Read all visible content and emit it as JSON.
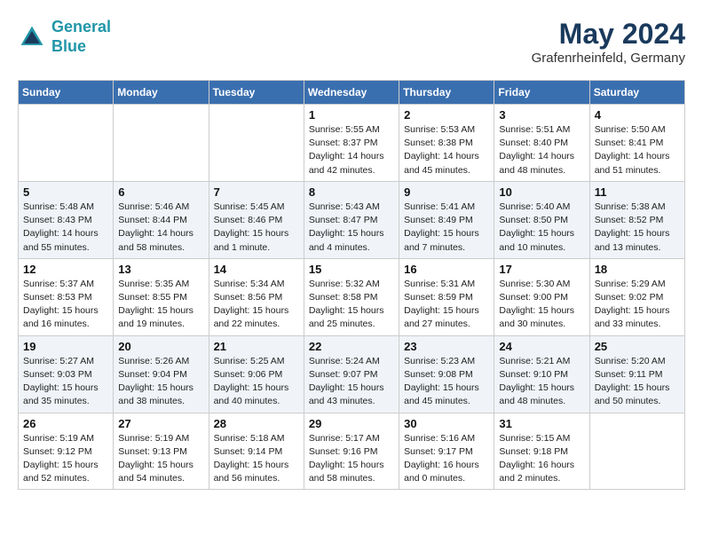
{
  "header": {
    "logo": {
      "line1": "General",
      "line2": "Blue"
    },
    "title": "May 2024",
    "location": "Grafenrheinfeld, Germany"
  },
  "weekdays": [
    "Sunday",
    "Monday",
    "Tuesday",
    "Wednesday",
    "Thursday",
    "Friday",
    "Saturday"
  ],
  "weeks": [
    [
      {
        "day": "",
        "info": ""
      },
      {
        "day": "",
        "info": ""
      },
      {
        "day": "",
        "info": ""
      },
      {
        "day": "1",
        "info": "Sunrise: 5:55 AM\nSunset: 8:37 PM\nDaylight: 14 hours\nand 42 minutes."
      },
      {
        "day": "2",
        "info": "Sunrise: 5:53 AM\nSunset: 8:38 PM\nDaylight: 14 hours\nand 45 minutes."
      },
      {
        "day": "3",
        "info": "Sunrise: 5:51 AM\nSunset: 8:40 PM\nDaylight: 14 hours\nand 48 minutes."
      },
      {
        "day": "4",
        "info": "Sunrise: 5:50 AM\nSunset: 8:41 PM\nDaylight: 14 hours\nand 51 minutes."
      }
    ],
    [
      {
        "day": "5",
        "info": "Sunrise: 5:48 AM\nSunset: 8:43 PM\nDaylight: 14 hours\nand 55 minutes."
      },
      {
        "day": "6",
        "info": "Sunrise: 5:46 AM\nSunset: 8:44 PM\nDaylight: 14 hours\nand 58 minutes."
      },
      {
        "day": "7",
        "info": "Sunrise: 5:45 AM\nSunset: 8:46 PM\nDaylight: 15 hours\nand 1 minute."
      },
      {
        "day": "8",
        "info": "Sunrise: 5:43 AM\nSunset: 8:47 PM\nDaylight: 15 hours\nand 4 minutes."
      },
      {
        "day": "9",
        "info": "Sunrise: 5:41 AM\nSunset: 8:49 PM\nDaylight: 15 hours\nand 7 minutes."
      },
      {
        "day": "10",
        "info": "Sunrise: 5:40 AM\nSunset: 8:50 PM\nDaylight: 15 hours\nand 10 minutes."
      },
      {
        "day": "11",
        "info": "Sunrise: 5:38 AM\nSunset: 8:52 PM\nDaylight: 15 hours\nand 13 minutes."
      }
    ],
    [
      {
        "day": "12",
        "info": "Sunrise: 5:37 AM\nSunset: 8:53 PM\nDaylight: 15 hours\nand 16 minutes."
      },
      {
        "day": "13",
        "info": "Sunrise: 5:35 AM\nSunset: 8:55 PM\nDaylight: 15 hours\nand 19 minutes."
      },
      {
        "day": "14",
        "info": "Sunrise: 5:34 AM\nSunset: 8:56 PM\nDaylight: 15 hours\nand 22 minutes."
      },
      {
        "day": "15",
        "info": "Sunrise: 5:32 AM\nSunset: 8:58 PM\nDaylight: 15 hours\nand 25 minutes."
      },
      {
        "day": "16",
        "info": "Sunrise: 5:31 AM\nSunset: 8:59 PM\nDaylight: 15 hours\nand 27 minutes."
      },
      {
        "day": "17",
        "info": "Sunrise: 5:30 AM\nSunset: 9:00 PM\nDaylight: 15 hours\nand 30 minutes."
      },
      {
        "day": "18",
        "info": "Sunrise: 5:29 AM\nSunset: 9:02 PM\nDaylight: 15 hours\nand 33 minutes."
      }
    ],
    [
      {
        "day": "19",
        "info": "Sunrise: 5:27 AM\nSunset: 9:03 PM\nDaylight: 15 hours\nand 35 minutes."
      },
      {
        "day": "20",
        "info": "Sunrise: 5:26 AM\nSunset: 9:04 PM\nDaylight: 15 hours\nand 38 minutes."
      },
      {
        "day": "21",
        "info": "Sunrise: 5:25 AM\nSunset: 9:06 PM\nDaylight: 15 hours\nand 40 minutes."
      },
      {
        "day": "22",
        "info": "Sunrise: 5:24 AM\nSunset: 9:07 PM\nDaylight: 15 hours\nand 43 minutes."
      },
      {
        "day": "23",
        "info": "Sunrise: 5:23 AM\nSunset: 9:08 PM\nDaylight: 15 hours\nand 45 minutes."
      },
      {
        "day": "24",
        "info": "Sunrise: 5:21 AM\nSunset: 9:10 PM\nDaylight: 15 hours\nand 48 minutes."
      },
      {
        "day": "25",
        "info": "Sunrise: 5:20 AM\nSunset: 9:11 PM\nDaylight: 15 hours\nand 50 minutes."
      }
    ],
    [
      {
        "day": "26",
        "info": "Sunrise: 5:19 AM\nSunset: 9:12 PM\nDaylight: 15 hours\nand 52 minutes."
      },
      {
        "day": "27",
        "info": "Sunrise: 5:19 AM\nSunset: 9:13 PM\nDaylight: 15 hours\nand 54 minutes."
      },
      {
        "day": "28",
        "info": "Sunrise: 5:18 AM\nSunset: 9:14 PM\nDaylight: 15 hours\nand 56 minutes."
      },
      {
        "day": "29",
        "info": "Sunrise: 5:17 AM\nSunset: 9:16 PM\nDaylight: 15 hours\nand 58 minutes."
      },
      {
        "day": "30",
        "info": "Sunrise: 5:16 AM\nSunset: 9:17 PM\nDaylight: 16 hours\nand 0 minutes."
      },
      {
        "day": "31",
        "info": "Sunrise: 5:15 AM\nSunset: 9:18 PM\nDaylight: 16 hours\nand 2 minutes."
      },
      {
        "day": "",
        "info": ""
      }
    ]
  ]
}
